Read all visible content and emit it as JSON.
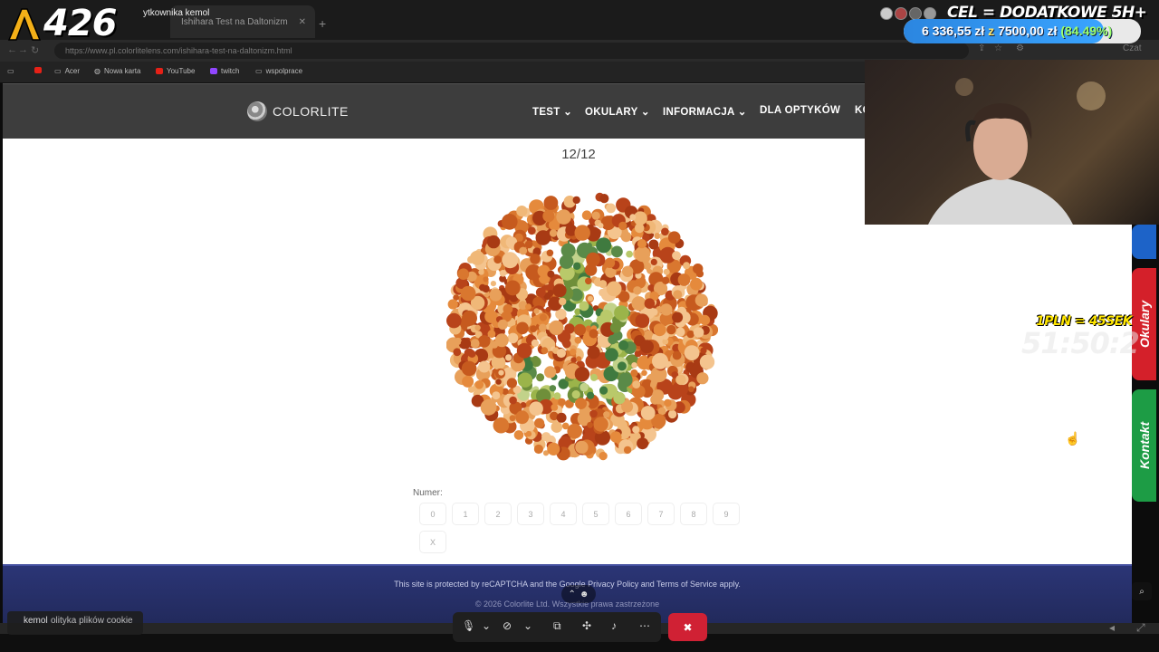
{
  "browser": {
    "tabs": [
      {
        "title": "ytkownika kemol"
      },
      {
        "title": "Ishihara Test na Daltonizm"
      }
    ],
    "url": "https://www.pl.colorlitelens.com/ishihara-test-na-daltonizm.html",
    "bookmarks": [
      {
        "label": "Acer",
        "icon": "folder-icon"
      },
      {
        "label": "Nowa karta",
        "icon": "globe-icon"
      },
      {
        "label": "YouTube",
        "icon": "youtube-icon",
        "color": "#e62117"
      },
      {
        "label": "twitch",
        "icon": "twitch-icon",
        "color": "#9146ff"
      },
      {
        "label": "wspolprace",
        "icon": "folder-icon"
      }
    ],
    "right_label": "Czat"
  },
  "site": {
    "logo": "COLORLITE",
    "menu": [
      {
        "label": "TEST ⌄"
      },
      {
        "label": "OKULARY ⌄"
      },
      {
        "label": "INFORMACJA ⌄"
      },
      {
        "label": "DLA OPTYKÓW"
      },
      {
        "label": "KO"
      }
    ],
    "progress": "12/12",
    "number_label": "Numer:",
    "number_buttons": [
      "0",
      "1",
      "2",
      "3",
      "4",
      "5",
      "6",
      "7",
      "8",
      "9"
    ],
    "extra_button": "X",
    "side_tabs": [
      "Okulary",
      "Kontakt"
    ],
    "footer": {
      "line1": "This site is protected by reCAPTCHA and the Google Privacy Policy and Terms of Service apply.",
      "line2": "© 2026 Colorlite Ltd. Wszystkie prawa zastrzeżone"
    }
  },
  "stream": {
    "counter": "426",
    "goal_title": "CEL = DODATKOWE 5H+",
    "goal_current": "6 336,55 zł",
    "goal_sep": "z",
    "goal_target": "7500,00 zł",
    "goal_pct_label": "(84.49%)",
    "goal_progress": 0.8449,
    "rate": "1PLN = 45SEK",
    "timer": "51:50:2",
    "cookie_text": "olityka plików cookie",
    "user": "kemol"
  },
  "colors": {
    "header_bg": "#3d3d3d",
    "footer_bg": "#2b3576",
    "side_red": "#d4202a",
    "side_green": "#1d9c45",
    "side_blue": "#1d63c8",
    "goal_fill": "#2b86e0"
  }
}
